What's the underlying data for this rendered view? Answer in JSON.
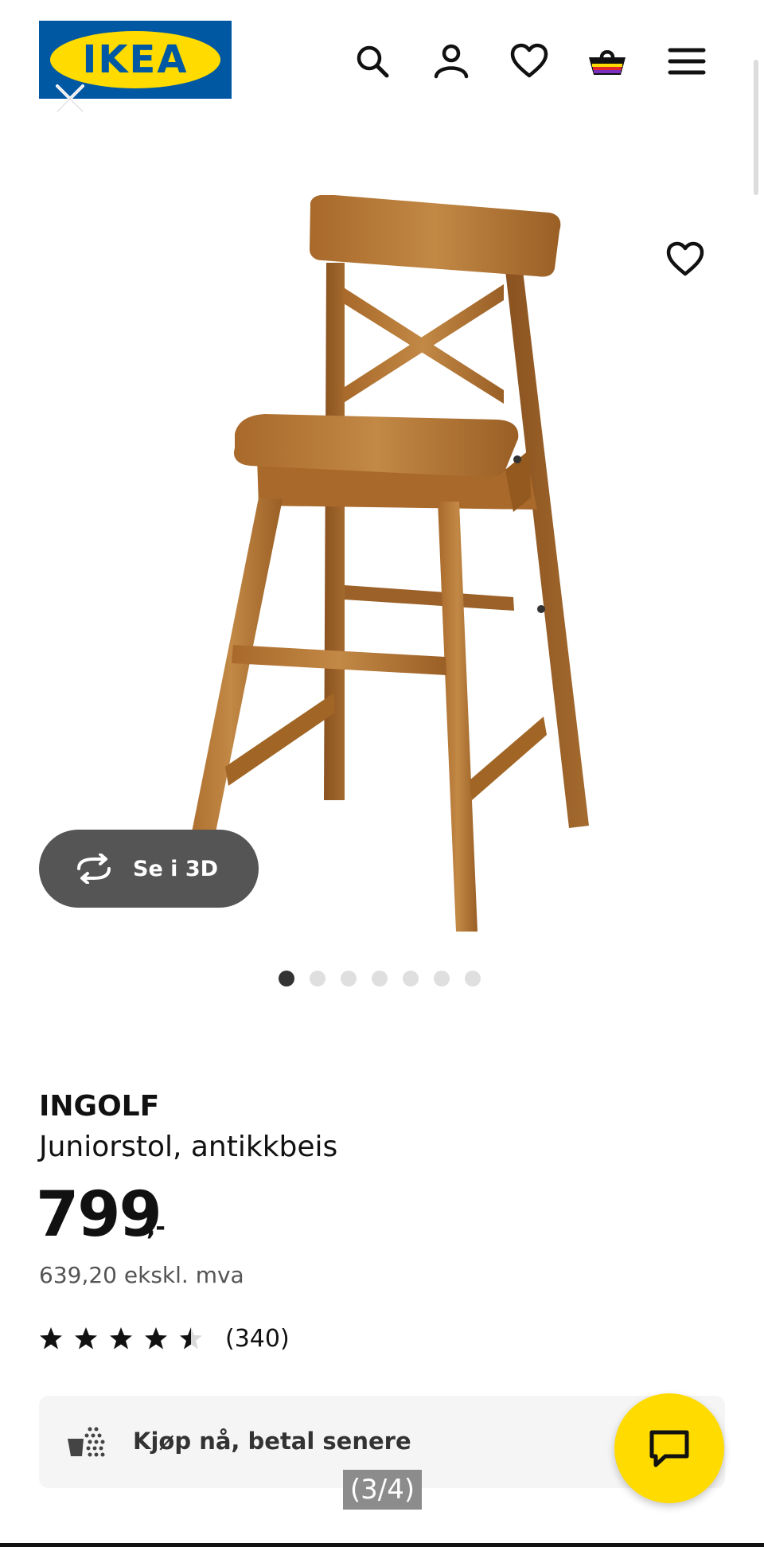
{
  "header": {
    "logo_text": "IKEA",
    "icons": [
      "search-icon",
      "account-icon",
      "heart-icon",
      "basket-icon",
      "menu-icon"
    ],
    "brand_colors": {
      "blue": "#0058A3",
      "yellow": "#FFDB00"
    }
  },
  "gallery": {
    "view_3d_label": "Se i 3D",
    "dots_total": 7,
    "dot_active": 1
  },
  "product": {
    "name": "INGOLF",
    "description": "Juniorstol, antikkbeis",
    "price": "799",
    "price_suffix": ",-",
    "price_excl_vat": "639,20 ekskl. mva",
    "rating": 4.5,
    "rating_max": 5,
    "review_count": "(340)"
  },
  "financing": {
    "label": "Kjøp nå, betal senere"
  },
  "overlay": {
    "page_indicator": "(3/4)"
  }
}
